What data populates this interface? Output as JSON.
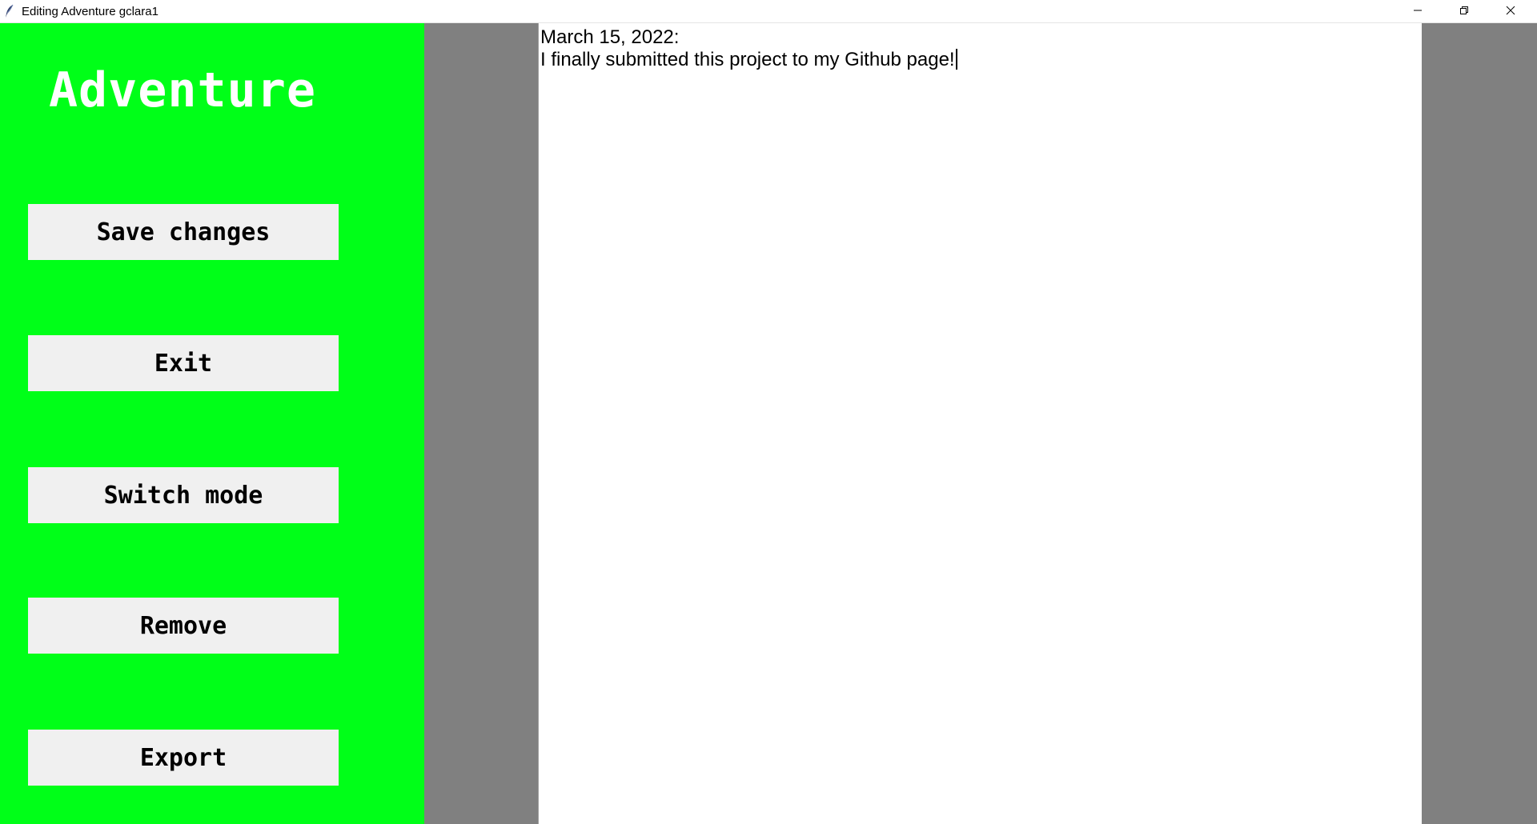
{
  "window": {
    "title": "Editing Adventure gclara1",
    "controls": {
      "minimize_icon": "minimize-icon",
      "maximize_icon": "restore-icon",
      "close_icon": "close-icon"
    }
  },
  "sidebar": {
    "title": "Adventure",
    "background": "#00ff18",
    "buttons": {
      "save": "Save changes",
      "exit": "Exit",
      "switch": "Switch mode",
      "remove": "Remove",
      "export": "Export"
    }
  },
  "editor": {
    "lines": [
      "March 15, 2022:",
      "I finally submitted this project to my Github page!"
    ]
  },
  "colors": {
    "sidebar_bg": "#00ff18",
    "canvas_bg": "#808080",
    "button_bg": "#f0f0f0"
  }
}
